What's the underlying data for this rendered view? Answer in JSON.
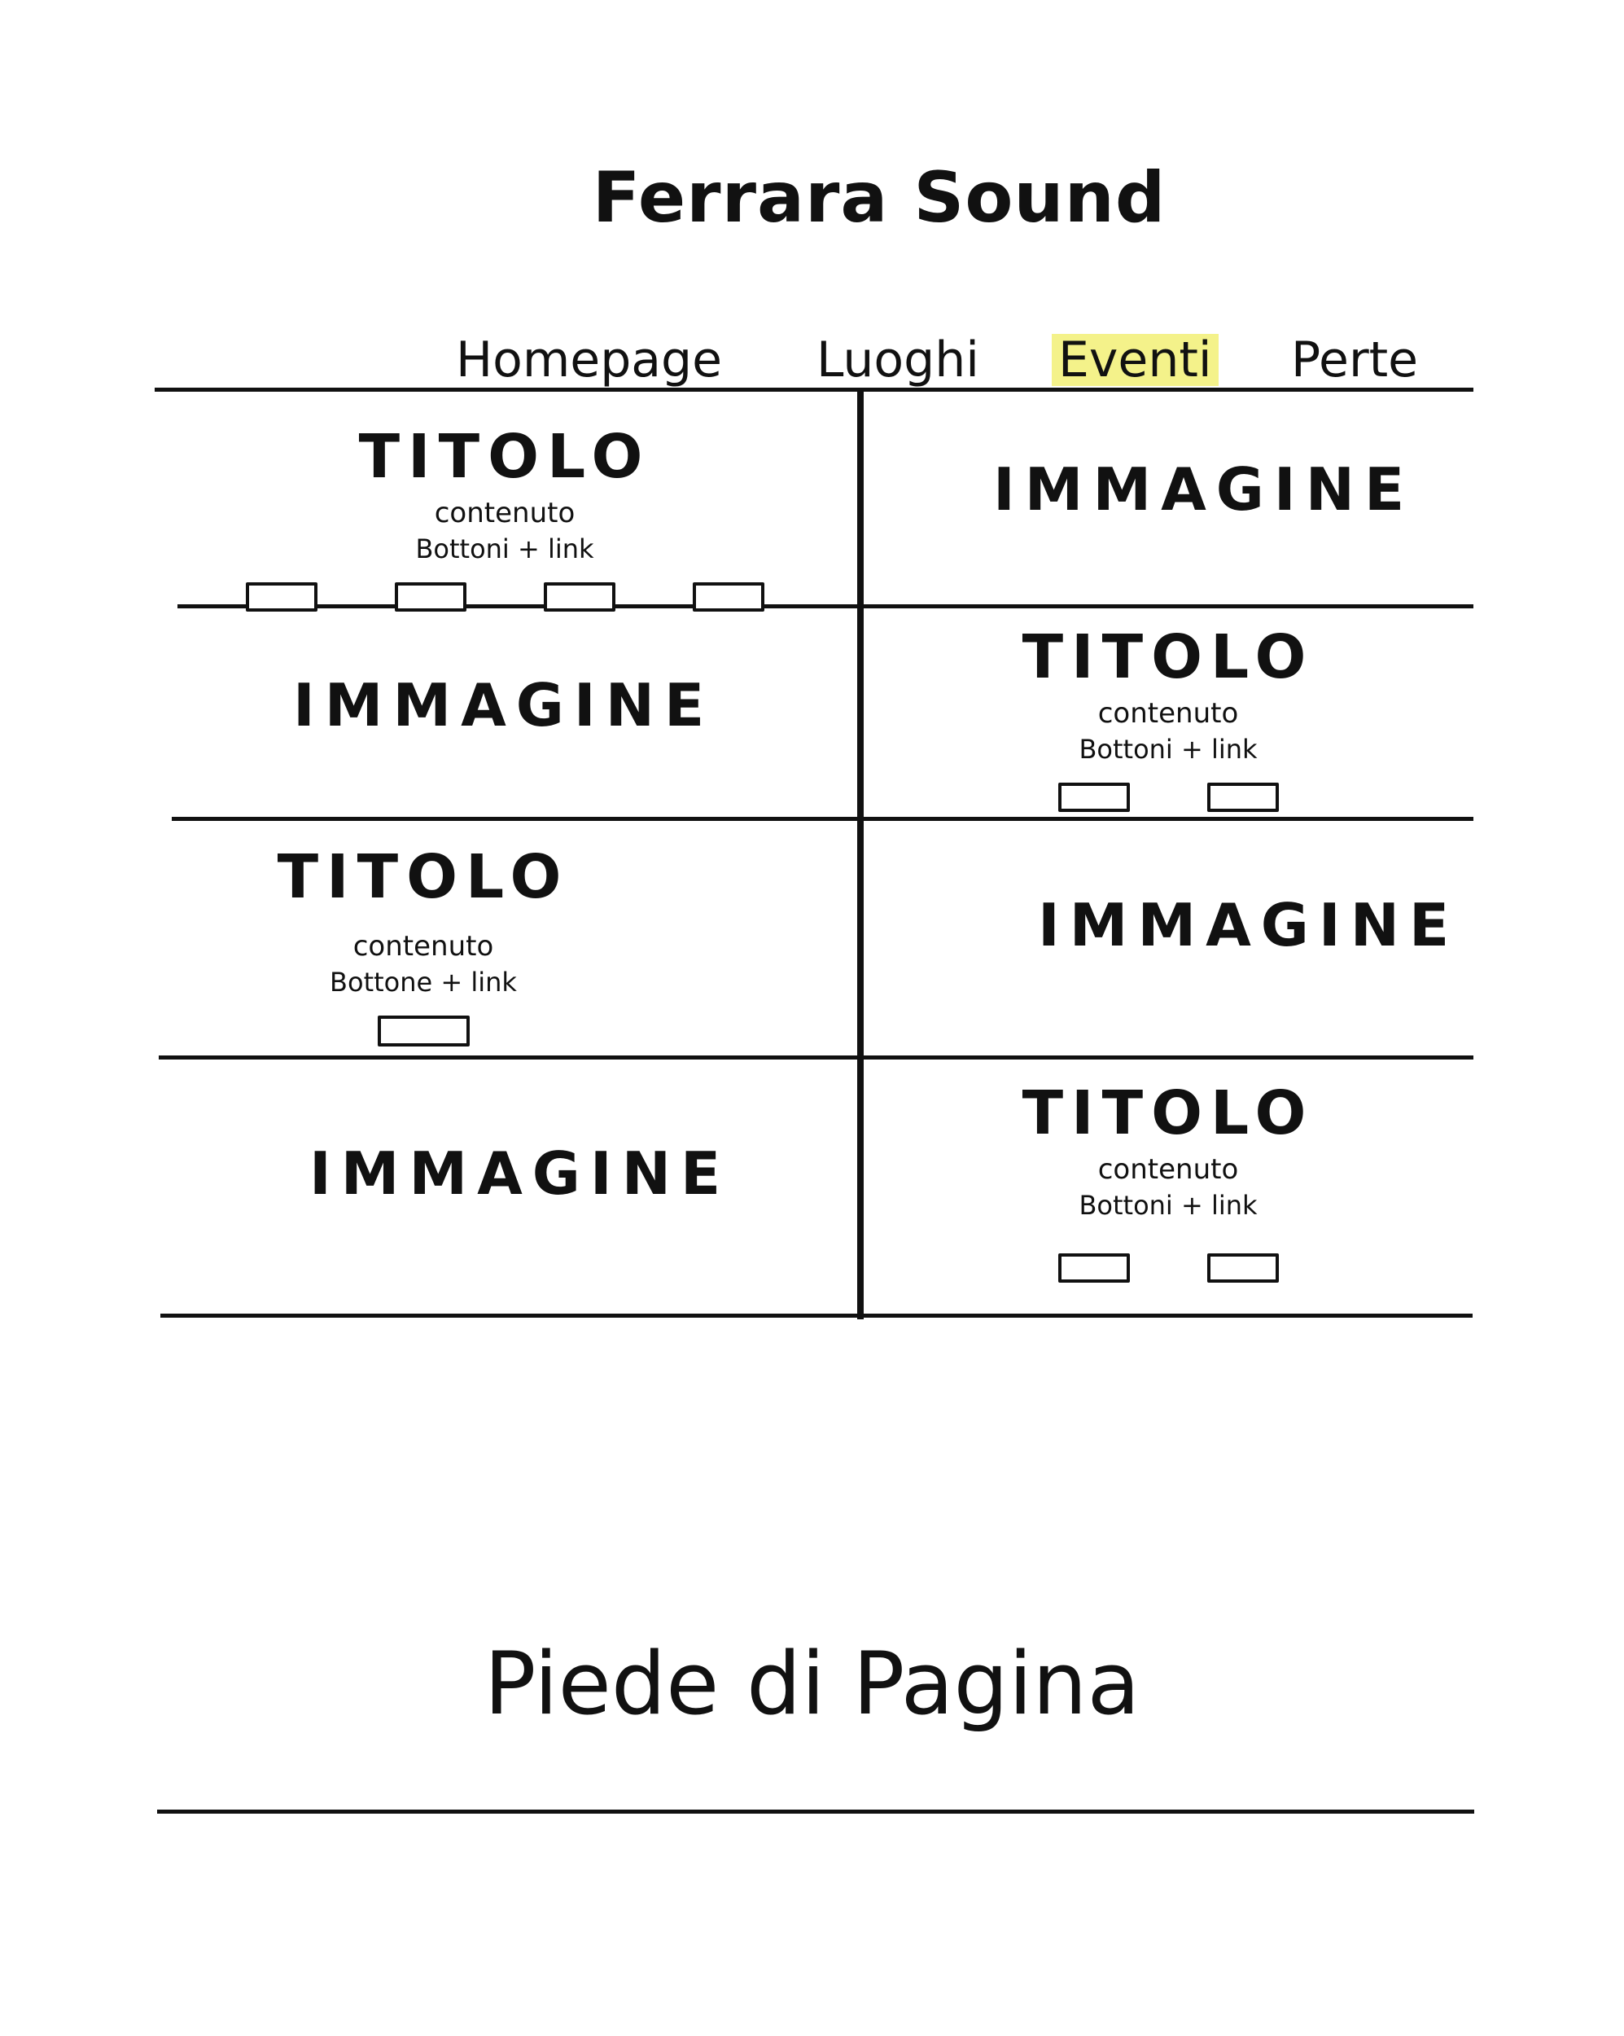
{
  "header": {
    "site_title": "Ferrara Sound"
  },
  "nav": {
    "items": [
      {
        "label": "Homepage",
        "active": false
      },
      {
        "label": "Luoghi",
        "active": false
      },
      {
        "label": "Eventi",
        "active": true
      },
      {
        "label": "Perte",
        "active": false
      }
    ]
  },
  "rows": [
    {
      "left": {
        "type": "text",
        "title": "TITOLO",
        "content": "contenuto",
        "buttons_label": "Bottoni + link",
        "button_count": 4
      },
      "right": {
        "type": "image",
        "label": "IMMAGINE"
      }
    },
    {
      "left": {
        "type": "image",
        "label": "IMMAGINE"
      },
      "right": {
        "type": "text",
        "title": "TITOLO",
        "content": "contenuto",
        "buttons_label": "Bottoni + link",
        "button_count": 2
      }
    },
    {
      "left": {
        "type": "text",
        "title": "TITOLO",
        "content": "contenuto",
        "buttons_label": "Bottone + link",
        "button_count": 1
      },
      "right": {
        "type": "image",
        "label": "IMMAGINE"
      }
    },
    {
      "left": {
        "type": "image",
        "label": "IMMAGINE"
      },
      "right": {
        "type": "text",
        "title": "TITOLO",
        "content": "contenuto",
        "buttons_label": "Bottoni + link",
        "button_count": 2
      }
    }
  ],
  "footer": {
    "label": "Piede di Pagina"
  }
}
